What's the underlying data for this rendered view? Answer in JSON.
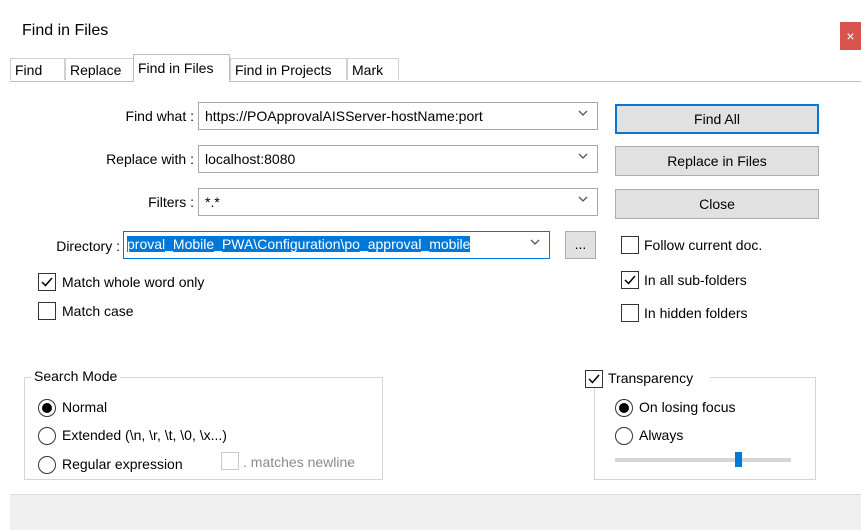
{
  "window": {
    "title": "Find in Files",
    "close_glyph": "×"
  },
  "tabs": [
    {
      "label": "Find"
    },
    {
      "label": "Replace"
    },
    {
      "label": "Find in Files"
    },
    {
      "label": "Find in Projects"
    },
    {
      "label": "Mark"
    }
  ],
  "form": {
    "find_what_label": "Find what :",
    "find_what_value": "https://POApprovalAISServer-hostName:port",
    "replace_with_label": "Replace with :",
    "replace_with_value": "localhost:8080",
    "filters_label": "Filters :",
    "filters_value": "*.*",
    "directory_label": "Directory :",
    "directory_value": "proval_Mobile_PWA\\Configuration\\po_approval_mobile",
    "browse_label": "...",
    "match_whole_word_label": "Match whole word only",
    "match_whole_word_checked": true,
    "match_case_label": "Match case",
    "match_case_checked": false
  },
  "buttons": {
    "find_all": "Find All",
    "replace_in_files": "Replace in Files",
    "close": "Close"
  },
  "options": {
    "follow_current_doc_label": "Follow current doc.",
    "follow_current_doc_checked": false,
    "in_all_subfolders_label": "In all sub-folders",
    "in_all_subfolders_checked": true,
    "in_hidden_folders_label": "In hidden folders",
    "in_hidden_folders_checked": false
  },
  "search_mode": {
    "title": "Search Mode",
    "normal_label": "Normal",
    "extended_label": "Extended (\\n, \\r, \\t, \\0, \\x...)",
    "regex_label": "Regular expression",
    "matches_newline_label": ". matches newline",
    "selected": "Normal"
  },
  "transparency": {
    "title": "Transparency",
    "checked": true,
    "on_losing_focus_label": "On losing focus",
    "always_label": "Always",
    "selected": "On losing focus",
    "slider_level": 0.7
  },
  "icons": {
    "chevron": "chevron-down-icon",
    "check": "check-icon",
    "close": "close-icon"
  },
  "colors": {
    "accent": "#0078d7",
    "close_button": "#d9534f"
  }
}
